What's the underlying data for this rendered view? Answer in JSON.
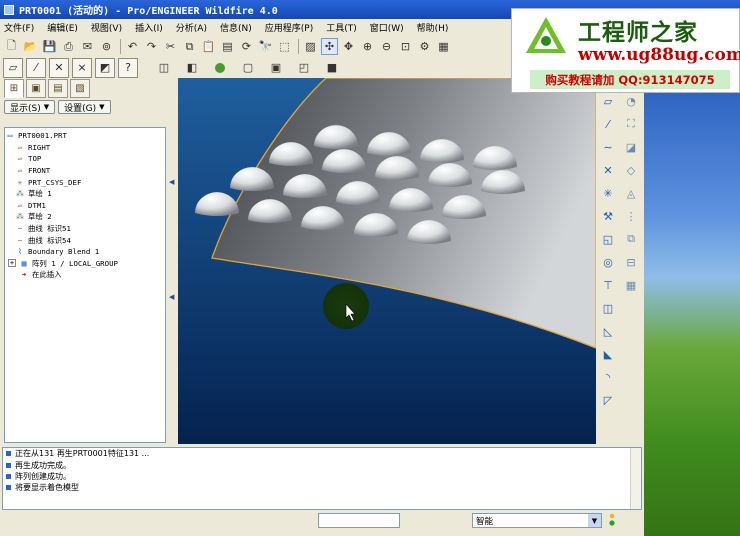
{
  "window": {
    "title": "PRT0001 (活动的) - Pro/ENGINEER Wildfire 4.0"
  },
  "menu": [
    "文件(F)",
    "编辑(E)",
    "视图(V)",
    "插入(I)",
    "分析(A)",
    "信息(N)",
    "应用程序(P)",
    "工具(T)",
    "窗口(W)",
    "帮助(H)"
  ],
  "toolbar_main": [
    "new-icon",
    "open-icon",
    "save-icon",
    "print-icon",
    "email-icon",
    "copy-disk-icon",
    "sep",
    "undo-icon",
    "redo-icon",
    "cut-icon",
    "copy-icon",
    "paste-icon",
    "paste-special-icon",
    "regenerate-icon",
    "find-icon",
    "select-box-icon",
    "sep",
    "repaint-icon",
    "spin-center-icon",
    "orient-icon",
    "zoom-in-icon",
    "zoom-out-icon",
    "refit-icon",
    "view-manager-icon",
    "saved-views-icon"
  ],
  "toolbar_display": [
    "datum-planes-icon",
    "datum-axes-icon",
    "datum-points-icon",
    "csys-icon",
    "shading-icon",
    "help-icon"
  ],
  "toolbar_right": [
    "layer-icon",
    "appearance-icon",
    "green-status-icon",
    "wireframe-icon",
    "hidden-line-icon",
    "no-hidden-icon",
    "shaded-icon"
  ],
  "panel": {
    "tabs": [
      "model-tree-tab",
      "folder-tab",
      "favorites-tab",
      "layer-tab"
    ],
    "show_button": "显示(S)",
    "settings_button": "设置(G)"
  },
  "tree": [
    {
      "label": "PRT0001.PRT",
      "icon": "part-icon"
    },
    {
      "label": "RIGHT",
      "icon": "datum-plane-icon"
    },
    {
      "label": "TOP",
      "icon": "datum-plane-icon"
    },
    {
      "label": "FRONT",
      "icon": "datum-plane-icon"
    },
    {
      "label": "PRT_CSYS_DEF",
      "icon": "csys-icon"
    },
    {
      "label": "草绘 1",
      "icon": "sketch-icon"
    },
    {
      "label": "DTM1",
      "icon": "datum-plane-icon"
    },
    {
      "label": "草绘 2",
      "icon": "sketch-icon"
    },
    {
      "label": "曲线 标识51",
      "icon": "curve-icon"
    },
    {
      "label": "曲线 标识54",
      "icon": "curve-icon"
    },
    {
      "label": "Boundary Blend 1",
      "icon": "blend-icon"
    },
    {
      "label": "阵列 1 / LOCAL_GROUP",
      "icon": "pattern-icon",
      "expandable": true
    },
    {
      "label": "在此插入",
      "icon": "insert-arrow-icon"
    }
  ],
  "messages": [
    "正在从131  再生PRT0001特征131 ...",
    "再生成功完成。",
    "阵列创建成功。",
    "将要显示着色模型"
  ],
  "status": {
    "filter_value": "智能"
  },
  "logo": {
    "brand": "工程师之家",
    "url": "www.ug88ug.com",
    "promo": "购买教程请加 QQ:913147075"
  },
  "viewport": {
    "domes_rows": [
      4,
      5,
      5,
      5
    ]
  },
  "colors": {
    "accent": "#1447b5",
    "viewport_top": "#1f5f9e",
    "viewport_bottom": "#04224f",
    "logo_green": "#1c5c10",
    "logo_red": "#c00000"
  }
}
